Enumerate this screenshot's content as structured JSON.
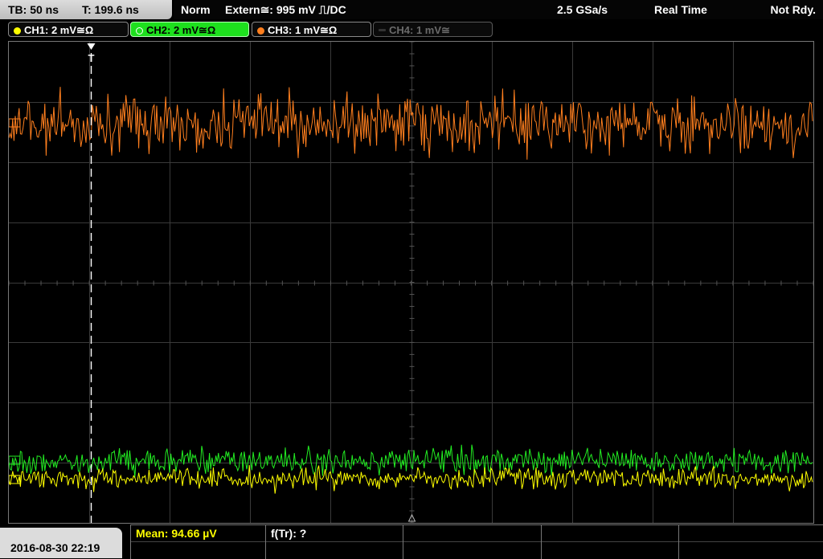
{
  "status": {
    "timebase": "TB: 50 ns",
    "trigger_time": "T: 199.6 ns",
    "mode": "Norm",
    "trigger_source": "Extern≅: 995 mV ⎍/DC",
    "sample_rate": "2.5 GSa/s",
    "acq_mode": "Real Time",
    "trigger_state": "Not Rdy."
  },
  "channels": [
    {
      "label": "CH1: 2 mV≅Ω",
      "color": "#ffff00"
    },
    {
      "label": "CH2: 2 mV≅Ω",
      "color": "#ffffff"
    },
    {
      "label": "CH3: 1 mV≅Ω",
      "color": "#ff7f1e"
    },
    {
      "label": "CH4: 1 mV≅",
      "color": "#555555"
    }
  ],
  "trace_colors": {
    "ch1": "#ffff00",
    "ch2": "#22ee22",
    "ch3": "#ff7f1e"
  },
  "trigger_marker": "T",
  "footer": {
    "datetime": "2016-08-30 22:19",
    "measurement": "Mean: 94.66 µV",
    "measurement_color": "#ffff00",
    "function": "f(Tr): ?"
  }
}
